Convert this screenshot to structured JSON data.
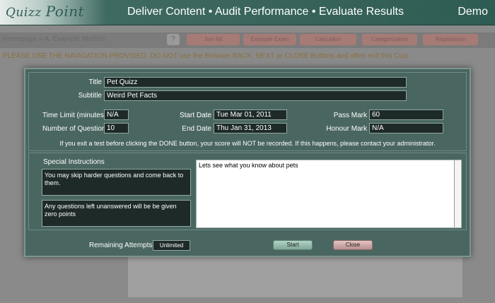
{
  "header": {
    "logo_text": "Quizz",
    "logo_point": "Point",
    "tagline": "Deliver Content • Audit Performance • Evaluate Results",
    "user_label": "Demo"
  },
  "background": {
    "breadcrumb": "Homepage » A. Example Models",
    "help_label": "?",
    "warning": "PLEASE USE THE NAVIGATION PROVIDED. DO NOT use the Browser BACK, NEXT or CLOSE Buttons and often exit this Cuiz.",
    "buttons": [
      "Join list",
      "Example Exam",
      "Calculator",
      "Categorization",
      "Registration"
    ]
  },
  "quiz": {
    "title_label": "Title",
    "title_value": "Pet Quizz",
    "subtitle_label": "Subtitle",
    "subtitle_value": "Weird Pet Facts",
    "time_limit_label": "Time Limit (minutes)",
    "time_limit_value": "N/A",
    "num_questions_label": "Number of Questions",
    "num_questions_value": "10",
    "start_date_label": "Start Date",
    "start_date_value": "Tue Mar 01, 2011",
    "end_date_label": "End Date",
    "end_date_value": "Thu Jan 31, 2013",
    "pass_mark_label": "Pass Mark",
    "pass_mark_value": "60",
    "honour_mark_label": "Honour Mark",
    "honour_mark_value": "N/A",
    "exit_note": "If you exit a test before clicking the DONE button, your score will NOT be recorded. If this happens, please contact your administrator."
  },
  "instructions": {
    "label": "Special Instructions",
    "items": [
      "You may skip harder questions and come back to them.",
      "Any questions left unanswered will be be given zero points"
    ],
    "message": "Lets see what you know about pets"
  },
  "footer": {
    "remaining_label": "Remaining Attempts",
    "remaining_value": "Unlimited",
    "start_label": "Start",
    "close_label": "Close"
  }
}
